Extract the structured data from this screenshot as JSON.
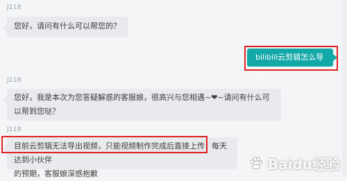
{
  "messages": [
    {
      "sender": "J118",
      "text": "您好，请问有什么可以帮您的？"
    },
    {
      "text": "bilibili云剪辑怎么导出"
    },
    {
      "sender": "J118",
      "line1": "您好，我是本次为您答疑解惑的客服娘，很高兴与您相遇~❤~请问有什么可",
      "line2": "以帮到您哒？"
    },
    {
      "sender": "J118",
      "line1a": "目前云剪辑无法导出视频，只能视频制作完成后直接上传",
      "line1b": "每天达到小伙伴",
      "line2": "的预期，客服娘深感抱歉"
    }
  ],
  "watermark": "Baidu经验",
  "colors": {
    "accent": "#13a8a8",
    "highlight": "#e02020"
  }
}
